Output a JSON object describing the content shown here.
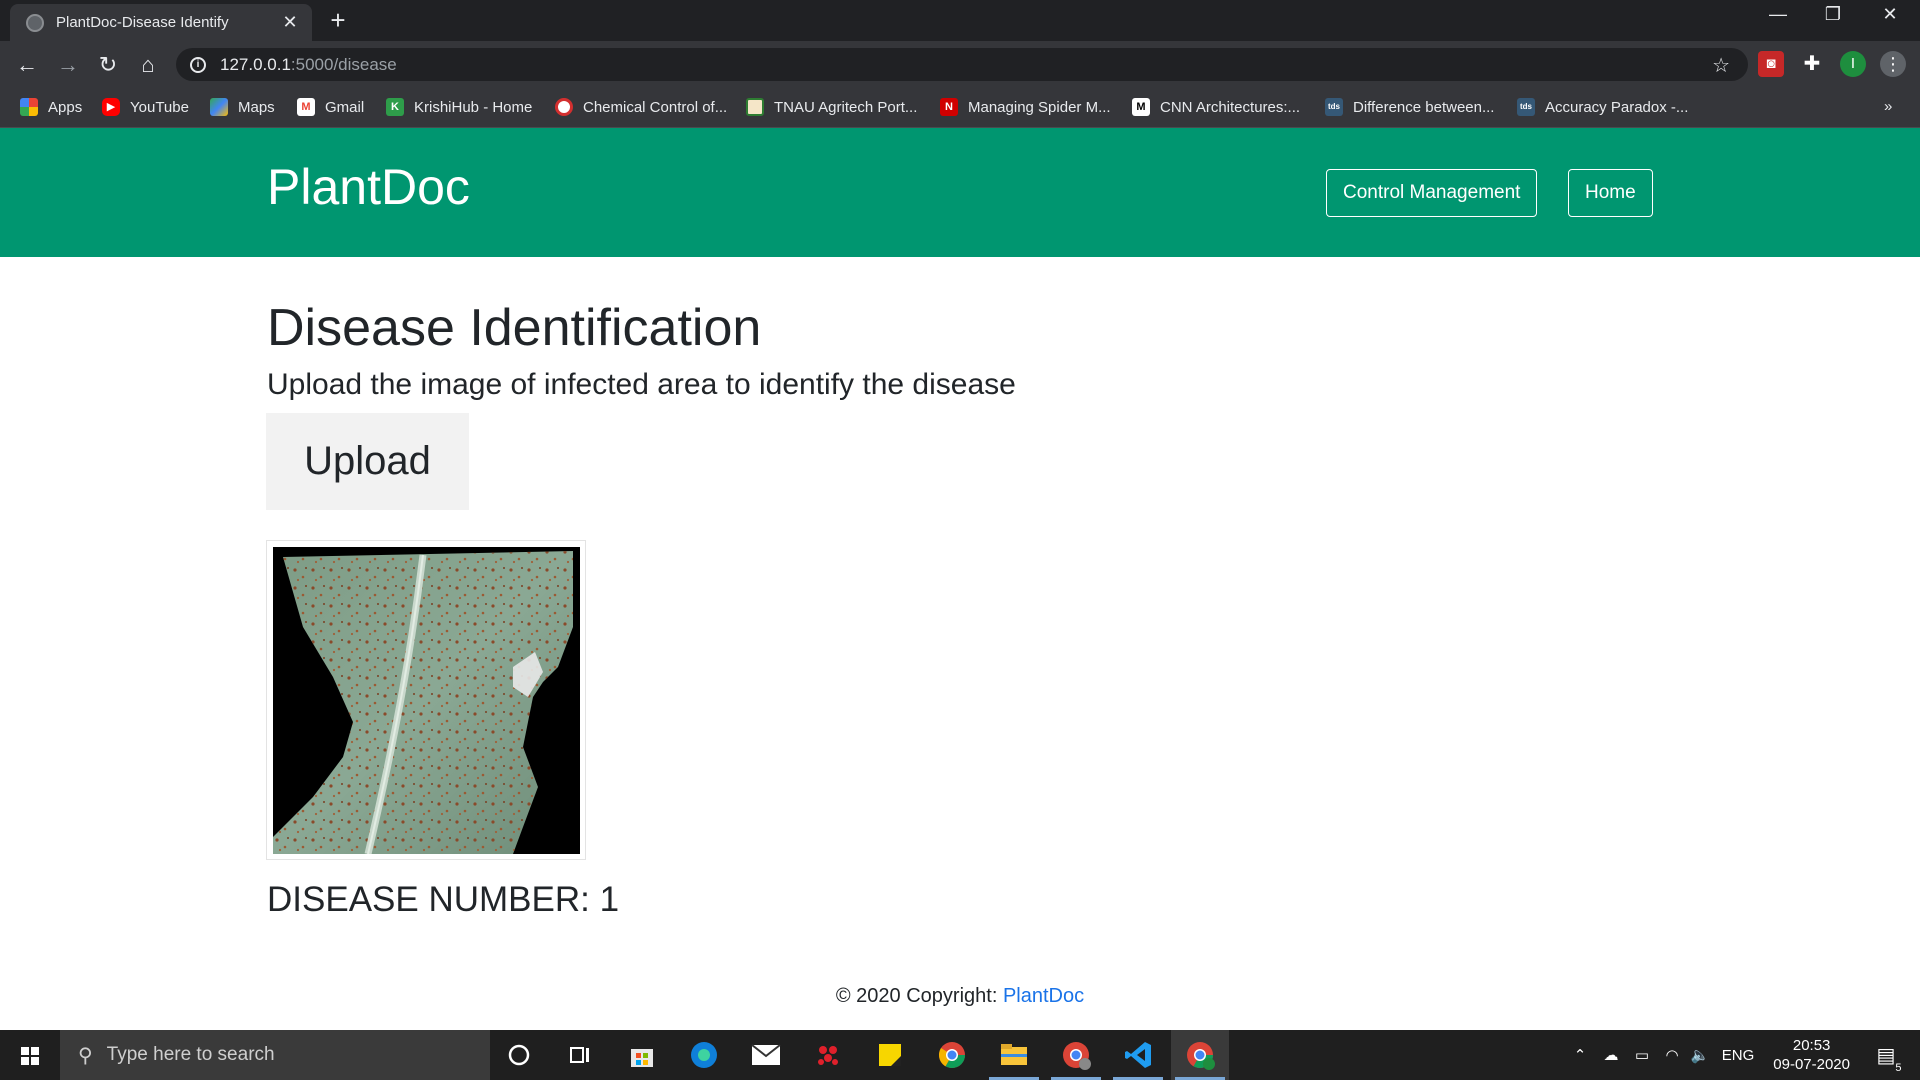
{
  "browser": {
    "tab_title": "PlantDoc-Disease Identify",
    "url_host": "127.0.0.1",
    "url_path": ":5000/disease",
    "profile_initial": "I",
    "bookmarks": [
      {
        "label": "Apps",
        "icon": "apps-grid-icon"
      },
      {
        "label": "YouTube",
        "icon": "youtube-icon"
      },
      {
        "label": "Maps",
        "icon": "maps-icon"
      },
      {
        "label": "Gmail",
        "icon": "gmail-icon"
      },
      {
        "label": "KrishiHub - Home",
        "icon": "krishihub-icon"
      },
      {
        "label": "Chemical Control of...",
        "icon": "chemical-icon"
      },
      {
        "label": "TNAU Agritech Port...",
        "icon": "tnau-icon"
      },
      {
        "label": "Managing Spider M...",
        "icon": "nebraska-icon"
      },
      {
        "label": "CNN Architectures:...",
        "icon": "medium-icon"
      },
      {
        "label": "Difference between...",
        "icon": "tds-icon"
      },
      {
        "label": "Accuracy Paradox -...",
        "icon": "tds-icon"
      }
    ],
    "bookmarks_overflow": "»"
  },
  "navbar": {
    "brand": "PlantDoc",
    "control_label": "Control Management",
    "home_label": "Home"
  },
  "main": {
    "title": "Disease Identification",
    "subtitle": "Upload the image of infected area to identify the disease",
    "upload_label": "Upload",
    "result": "DISEASE NUMBER: 1"
  },
  "footer": {
    "text": "© 2020 Copyright: ",
    "link": "PlantDoc"
  },
  "taskbar": {
    "search_placeholder": "Type here to search",
    "language": "ENG",
    "time": "20:53",
    "date": "09-07-2020",
    "notification_count": "5"
  },
  "colors": {
    "navbar": "#009670",
    "link": "#1a73e8"
  }
}
